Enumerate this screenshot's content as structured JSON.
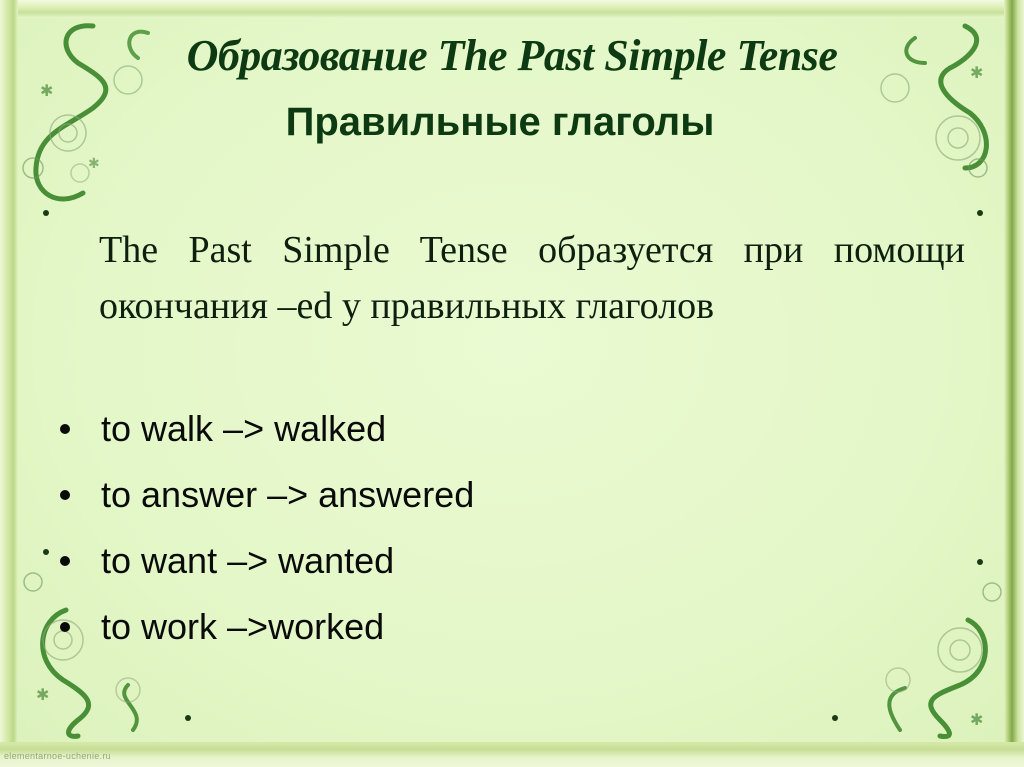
{
  "slide": {
    "title": "Образование The Past Simple Tense",
    "subtitle": "Правильные глаголы",
    "paragraph": "The Past Simple Tense образуется при помощи окончания –ed у правильных глаголов",
    "examples": [
      {
        "text": "to walk –> walked"
      },
      {
        "text": "to answer –> answered"
      },
      {
        "text": "to want –> wanted"
      },
      {
        "text": "to work –>worked"
      }
    ],
    "watermark": "elementarnoe-uchenie.ru"
  },
  "theme": {
    "background": "#e6f8c8",
    "text_dark_green": "#0d3a12",
    "frame_green": "#7fa84a",
    "ornament_green": "#2e7d1e"
  }
}
